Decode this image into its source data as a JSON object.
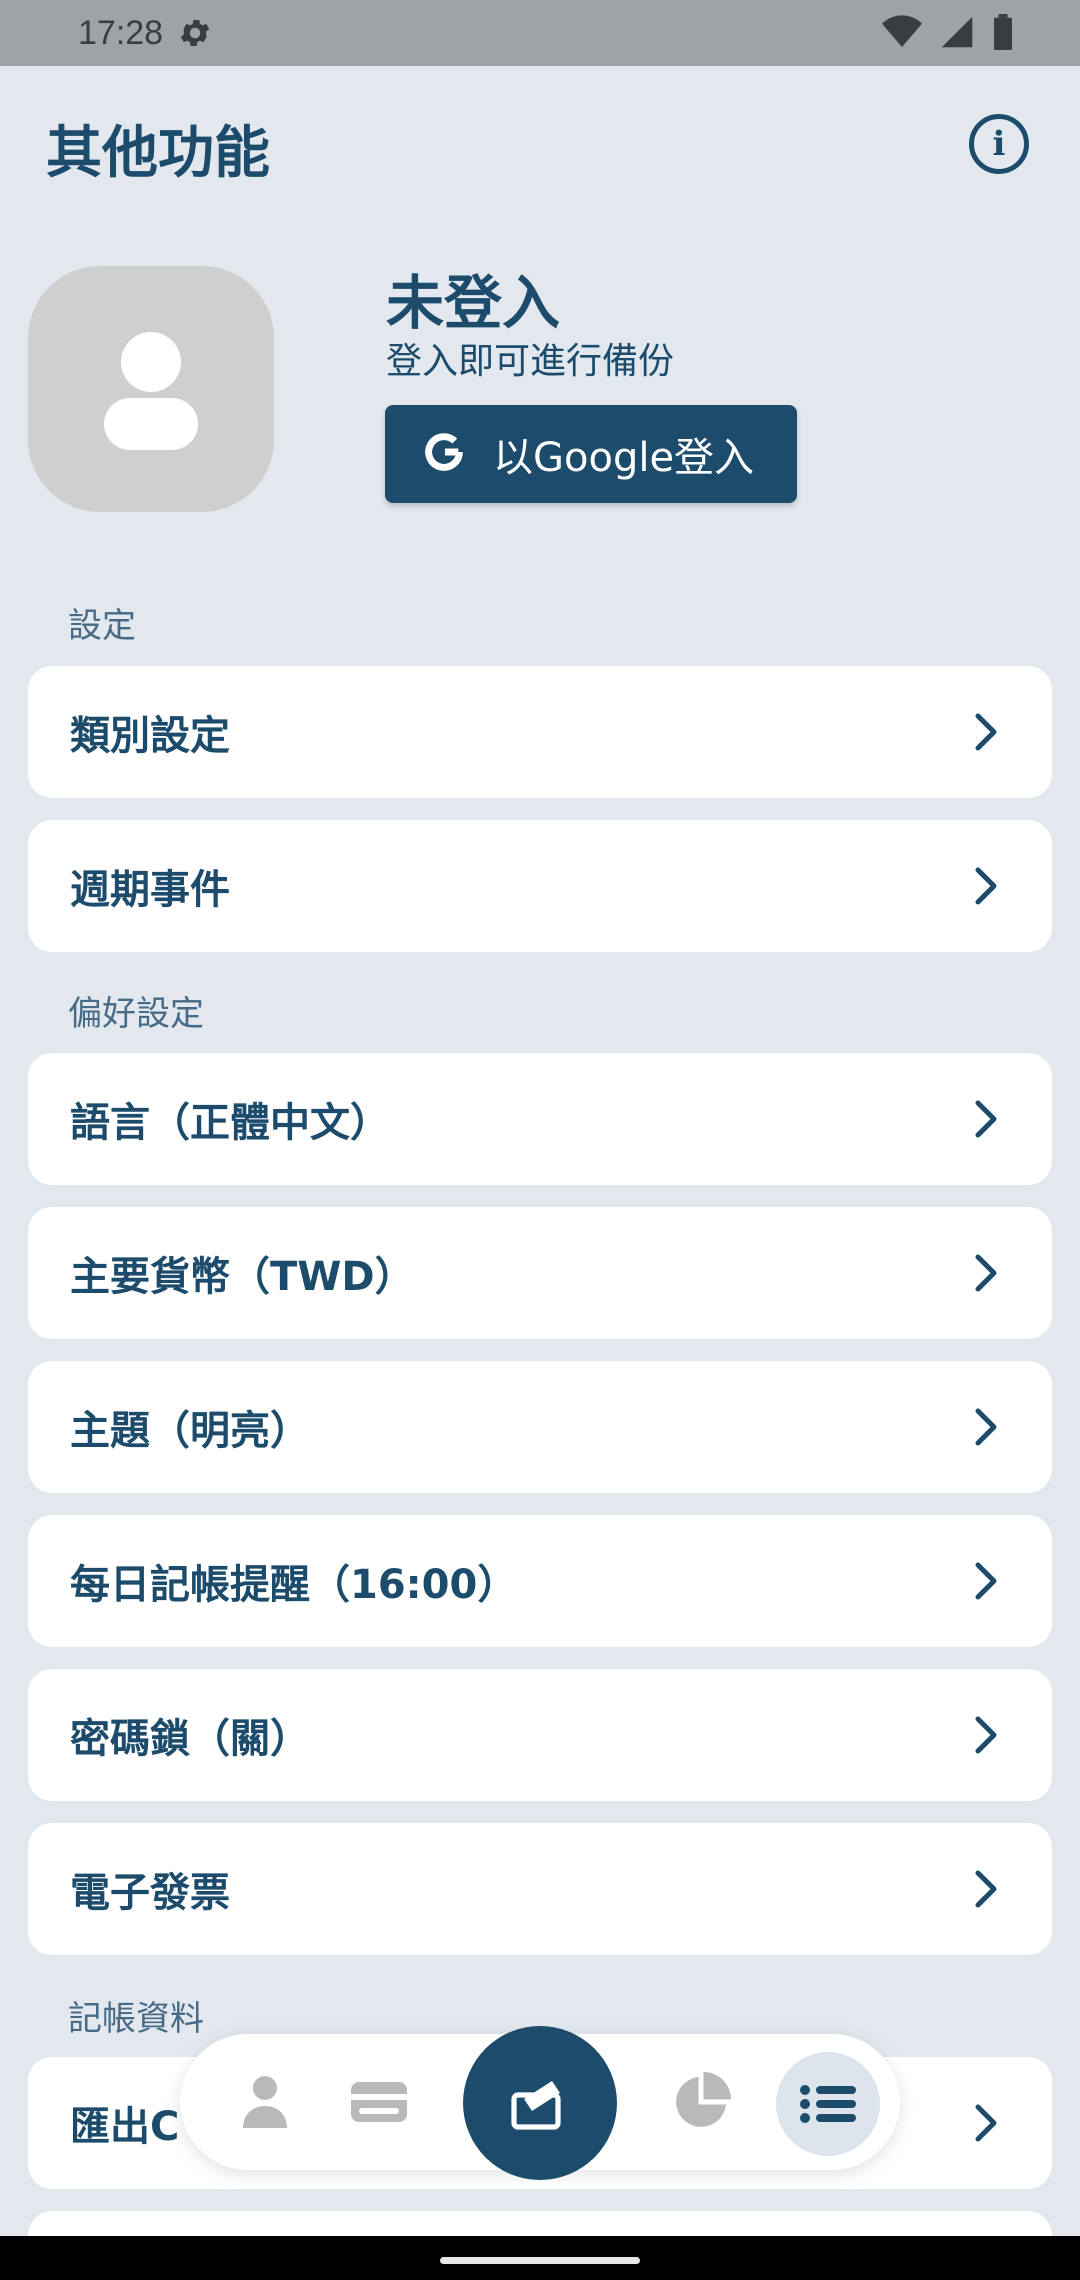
{
  "status_bar": {
    "time": "17:28"
  },
  "header": {
    "title": "其他功能",
    "info_icon": "info-icon"
  },
  "profile": {
    "name": "未登入",
    "subtitle": "登入即可進行備份",
    "google_button_label": "以Google登入"
  },
  "sections": {
    "settings": "設定",
    "preferences": "偏好設定",
    "records": "記帳資料"
  },
  "menu": {
    "category_settings": "類別設定",
    "recurring_events": "週期事件",
    "language": "語言（正體中文）",
    "currency": "主要貨幣（TWD）",
    "theme": "主題（明亮）",
    "reminder": "每日記帳提醒（16:00）",
    "passcode": "密碼鎖（關）",
    "einvoice": "電子發票",
    "export": "匯出C"
  },
  "colors": {
    "primary": "#1c4b6b",
    "background": "#e3e8ef",
    "card": "#ffffff",
    "nav_inactive": "#b9b9b9"
  }
}
